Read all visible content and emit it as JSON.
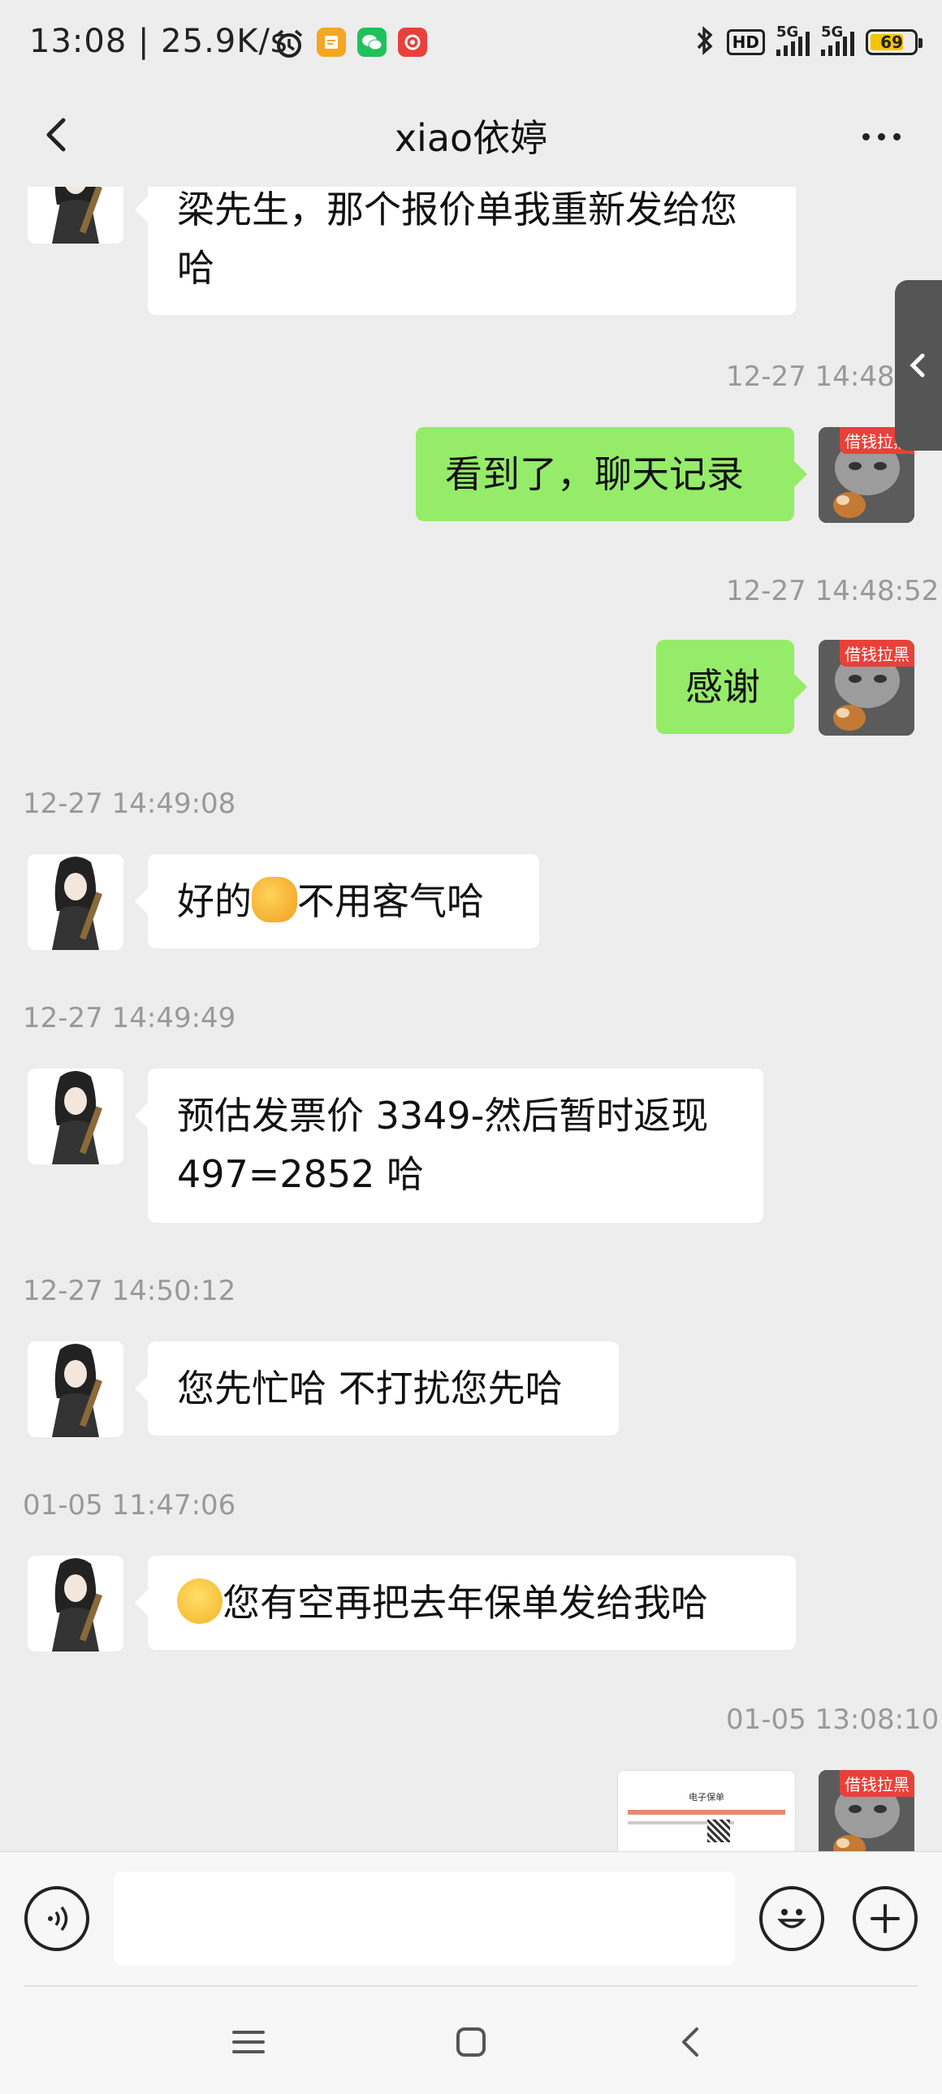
{
  "status_bar": {
    "time_speed": "13:08 | 25.9K/s",
    "network_hd": "HD",
    "network_1": "5G",
    "network_2": "5G",
    "battery": "69"
  },
  "nav": {
    "title": "xiao依婷"
  },
  "messages": [
    {
      "side": "left",
      "text": "梁先生，那个报价单我重新发给您哈"
    },
    {
      "timestamp": "12-27 14:48:4"
    },
    {
      "side": "right",
      "text": "看到了，聊天记录"
    },
    {
      "timestamp": "12-27 14:48:52"
    },
    {
      "side": "right",
      "text": "感谢"
    },
    {
      "timestamp": "12-27 14:49:08"
    },
    {
      "side": "left",
      "text": "好的",
      "text_after": "不用客气哈"
    },
    {
      "timestamp": "12-27 14:49:49"
    },
    {
      "side": "left",
      "text": "预估发票价 3349-然后暂时返现 497=2852 哈"
    },
    {
      "timestamp": "12-27 14:50:12"
    },
    {
      "side": "left",
      "text": "您先忙哈 不打扰您先哈"
    },
    {
      "timestamp": "01-05 11:47:06"
    },
    {
      "side": "left",
      "text": "您有空再把去年保单发给我哈"
    },
    {
      "timestamp": "01-05 13:08:10"
    },
    {
      "side": "right",
      "type": "image",
      "image_title": "电子保单"
    }
  ],
  "avatar_tag": "借钱拉黑",
  "icons": {
    "back": "back-arrow-icon",
    "more": "more-dots-icon",
    "voice": "voice-icon",
    "emoji": "emoji-icon",
    "plus": "plus-icon",
    "handshake": "handshake-emoji",
    "smile": "smile-emoji"
  },
  "colors": {
    "background": "#ededed",
    "bubble_self": "#95ec69",
    "bubble_other": "#ffffff",
    "timestamp": "#999999"
  }
}
